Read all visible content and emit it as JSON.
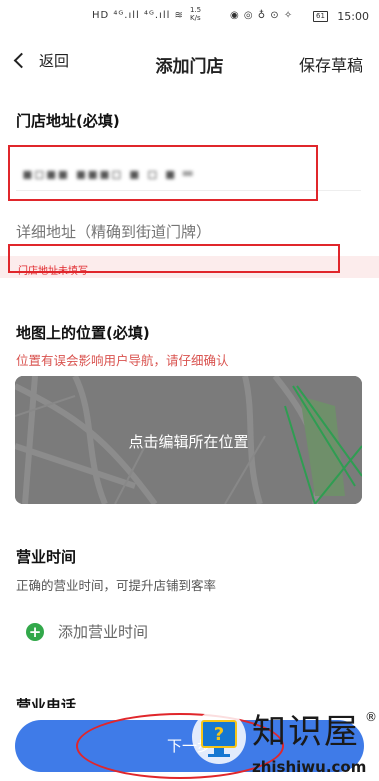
{
  "status_bar": {
    "left_icons": "HD ⁴ᴳ.ıll ⁴ᴳ.ıll ≋",
    "net_speed": "1.5 K/s",
    "right_icons": "◉ ◎ ♁ ⊙ ✧",
    "battery": "61",
    "time": "15:00"
  },
  "nav": {
    "back_label": "返回",
    "title": "添加门店",
    "save_label": "保存草稿"
  },
  "store_address": {
    "title": "门店地址(必填)",
    "value_blurred": "▪▫▪▪ ▪▪▪▫ ▪ ▫ ▪ ═",
    "detail_placeholder": "详细地址（精确到街道门牌）",
    "error": "门店地址未填写"
  },
  "map_location": {
    "title": "地图上的位置(必填)",
    "warning": "位置有误会影响用户导航，请仔细确认",
    "map_label": "点击编辑所在位置"
  },
  "business_hours": {
    "title": "营业时间",
    "subtitle": "正确的营业时间，可提升店铺到客率",
    "add_label": "添加营业时间"
  },
  "business_phone": {
    "title": "营业电话"
  },
  "next_button": {
    "label": "下一步"
  },
  "watermark": {
    "chinese": "知识屋",
    "registered": "®",
    "domain": "zhishiwu.com",
    "icon_glyph": "?"
  },
  "colors": {
    "primary": "#3f7be8",
    "error": "#e0262b",
    "warning_text": "#d9534f",
    "add_green": "#32a84a",
    "map_bg": "#7a7a7a"
  },
  "icons": {
    "back": "chevron-left-icon",
    "add": "plus-circle-icon"
  }
}
